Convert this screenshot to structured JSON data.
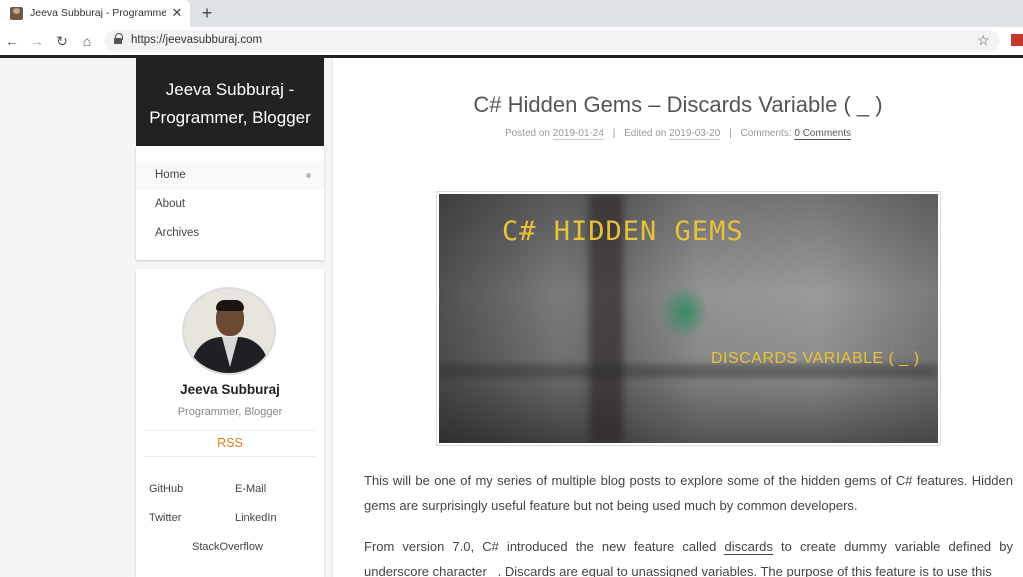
{
  "browser": {
    "tab_title": "Jeeva Subburaj - Programmer, Bl",
    "url": "https://jeevasubburaj.com",
    "icons": [
      "back-icon",
      "forward-icon",
      "reload-icon",
      "home-icon",
      "lock-icon",
      "star-icon",
      "close-icon",
      "plus-icon"
    ]
  },
  "sidebar": {
    "site_title_line1": "Jeeva Subburaj -",
    "site_title_line2": "Programmer, Blogger",
    "nav": [
      {
        "label": "Home"
      },
      {
        "label": "About"
      },
      {
        "label": "Archives"
      }
    ],
    "author_name": "Jeeva Subburaj",
    "author_desc": "Programmer, Blogger",
    "rss": "RSS",
    "social": {
      "github": "GitHub",
      "email": "E-Mail",
      "twitter": "Twitter",
      "linkedin": "LinkedIn",
      "stackoverflow": "StackOverflow"
    }
  },
  "post": {
    "title": "C# Hidden Gems – Discards Variable ( _ )",
    "posted_label": "Posted on",
    "posted_date": "2019-01-24",
    "edited_label": "Edited on",
    "edited_date": "2019-03-20",
    "comments_label": "Comments:",
    "comments_count": "0 Comments",
    "hero_title": "C# HIDDEN GEMS",
    "hero_subtitle": "DISCARDS VARIABLE ( _ )",
    "p1": "This will be one of my series of multiple blog posts to explore some of the hidden gems of C# features. Hidden gems are surprisingly useful feature but not being used much by common developers.",
    "p2_a": "From version 7.0, C# introduced the new feature called ",
    "p2_link": "discards",
    "p2_b": " to create dummy variable defined by underscore character _. Discards are equal to unassigned variables. The purpose of this feature is to use this"
  },
  "colors": {
    "accent": "#e67e22",
    "header_bg": "#222222",
    "hero_text": "#e8c33a"
  }
}
